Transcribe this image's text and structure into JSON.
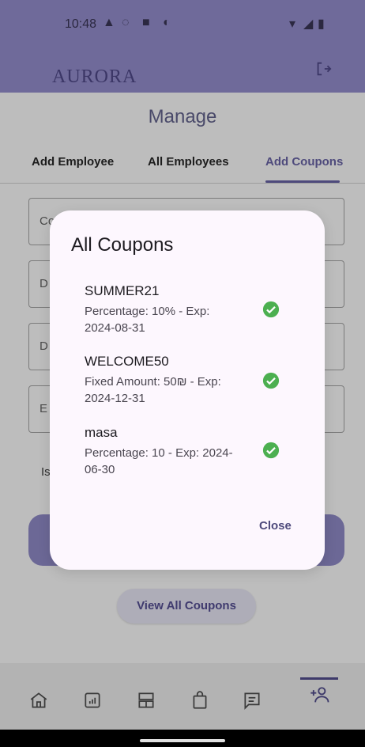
{
  "status_bar": {
    "time": "10:48"
  },
  "header": {
    "logo": "AURORA"
  },
  "page": {
    "title": "Manage"
  },
  "tabs": [
    {
      "label": "Add Employee"
    },
    {
      "label": "All Employees"
    },
    {
      "label": "Add Coupons",
      "active": true
    }
  ],
  "form": {
    "field_hints": [
      "Co",
      "D",
      "D",
      "E"
    ],
    "switch_label": "Is"
  },
  "view_all_button": "View All Coupons",
  "dialog": {
    "title": "All Coupons",
    "coupons": [
      {
        "code": "SUMMER21",
        "detail": "Percentage: 10% - Exp: 2024-08-31"
      },
      {
        "code": "WELCOME50",
        "detail": "Fixed Amount: 50₪ - Exp: 2024-12-31"
      },
      {
        "code": "masa",
        "detail": "Percentage: 10 - Exp: 2024-06-30"
      }
    ],
    "close_label": "Close"
  },
  "colors": {
    "accent": "#4e4a7c",
    "check": "#4caf50",
    "header": "#6f6a9a"
  },
  "icons": [
    "warning-icon",
    "vpn-icon",
    "sim-icon",
    "sync-icon",
    "wifi-icon",
    "signal-icon",
    "battery-icon",
    "logout-icon",
    "home-icon",
    "stats-icon",
    "dashboard-icon",
    "shopping-bag-icon",
    "message-icon",
    "add-person-icon",
    "check-circle-icon"
  ]
}
